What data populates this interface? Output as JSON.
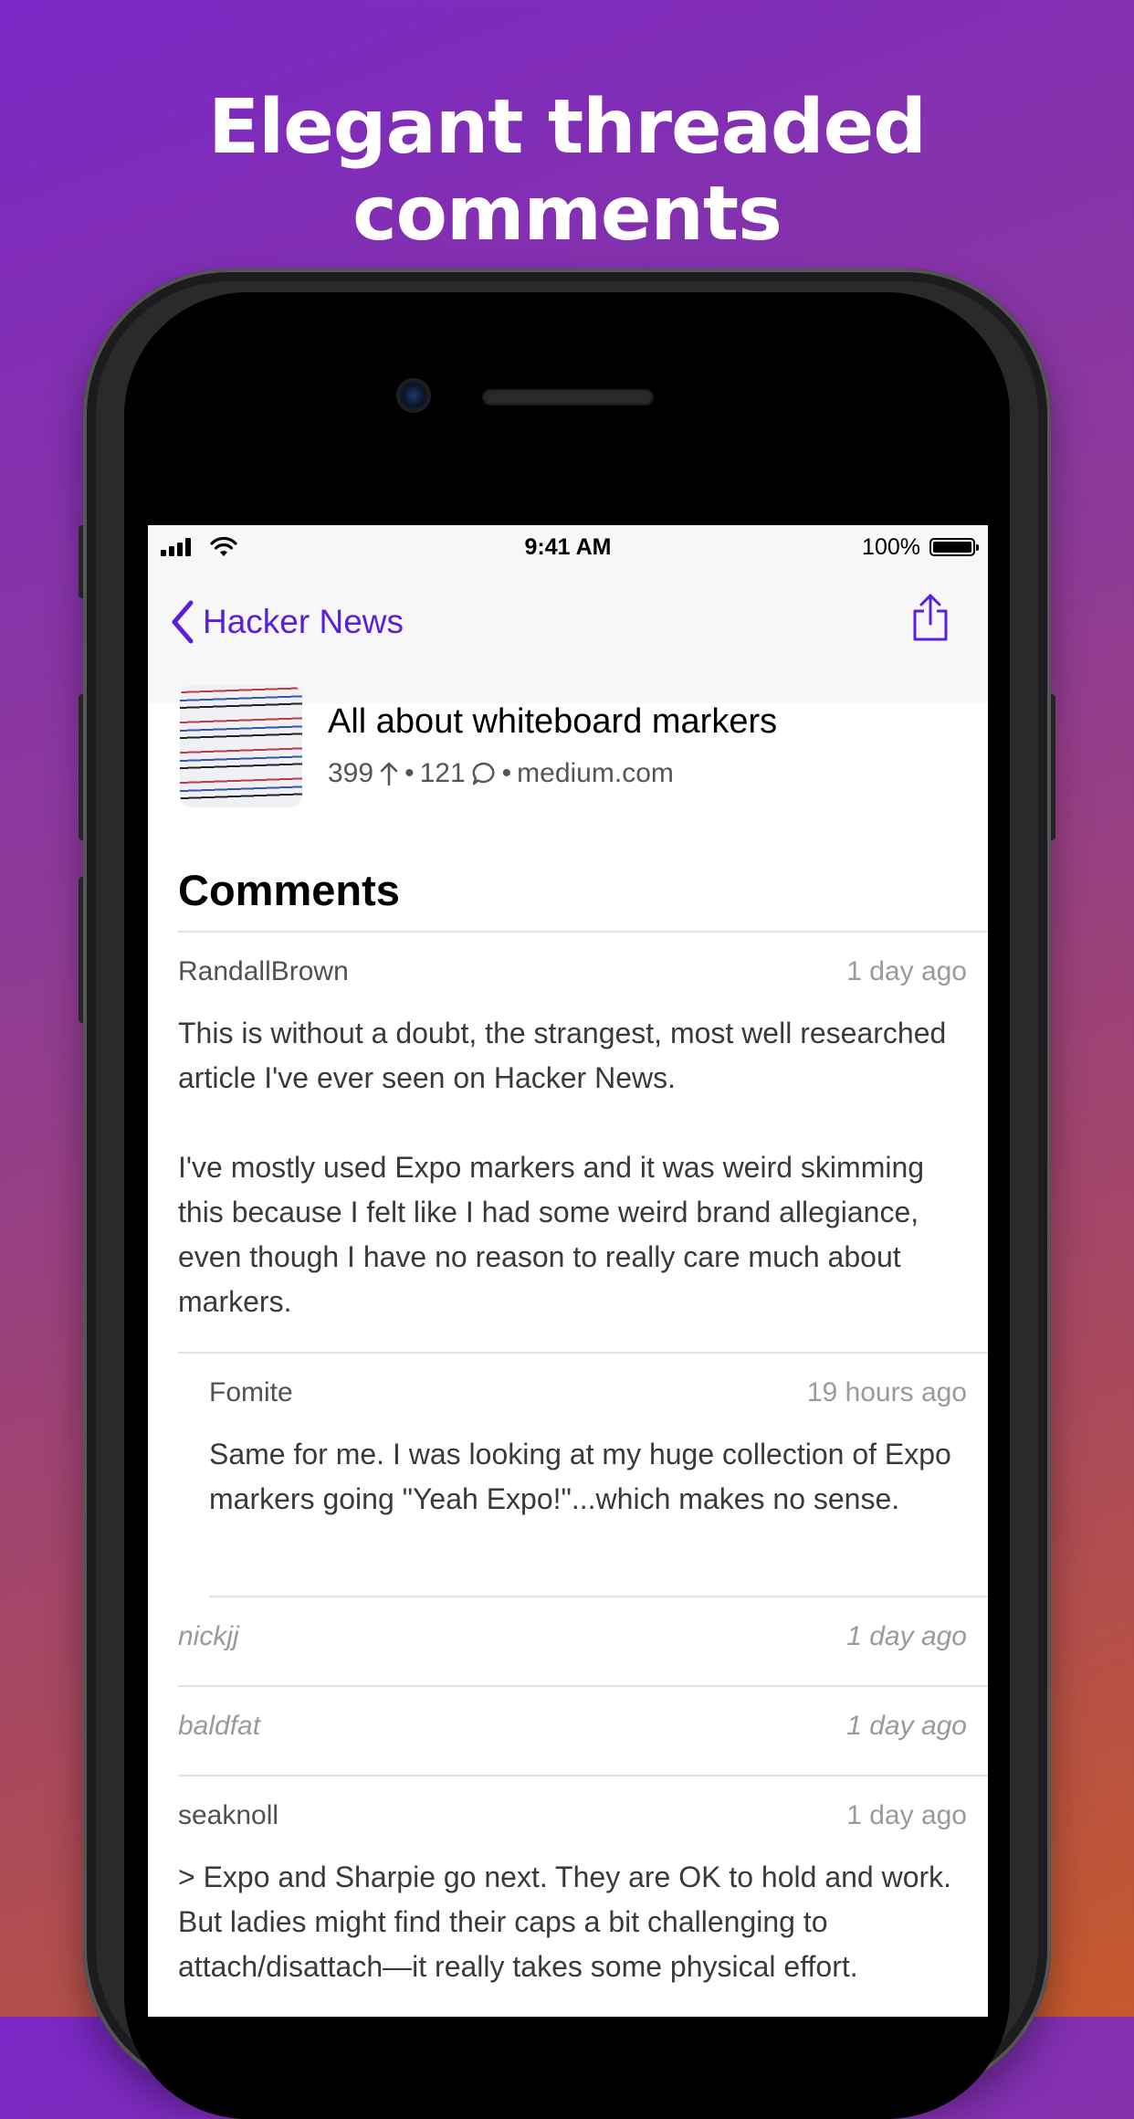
{
  "headline": "Elegant threaded comments",
  "status_bar": {
    "time": "9:41 AM",
    "battery": "100%"
  },
  "nav": {
    "back_label": "Hacker News",
    "accent": "#5a1fd6"
  },
  "story": {
    "title": "All about whiteboard markers",
    "points": "399",
    "comment_count": "121",
    "domain": "medium.com"
  },
  "section_title": "Comments",
  "comments": [
    {
      "author": "RandallBrown",
      "time": "1 day ago",
      "paragraphs": [
        "This is without a doubt, the strangest, most well researched article I've ever seen on Hacker News.",
        "I've mostly used Expo markers and it was weird skimming this because I felt like I had some weird brand allegiance, even though I have no reason to really care much about markers."
      ]
    },
    {
      "author": "Fomite",
      "time": "19 hours ago",
      "paragraphs": [
        "Same for me. I was looking at my huge collection of Expo markers going \"Yeah Expo!\"...which makes no sense."
      ]
    },
    {
      "author": "nickjj",
      "time": "1 day ago"
    },
    {
      "author": "baldfat",
      "time": "1 day ago"
    },
    {
      "author": "seaknoll",
      "time": "1 day ago",
      "paragraphs": [
        "> Expo and Sharpie go next. They are OK to hold and work. But ladies might find their caps a bit challenging to attach/disattach—it really takes some physical effort."
      ]
    }
  ]
}
